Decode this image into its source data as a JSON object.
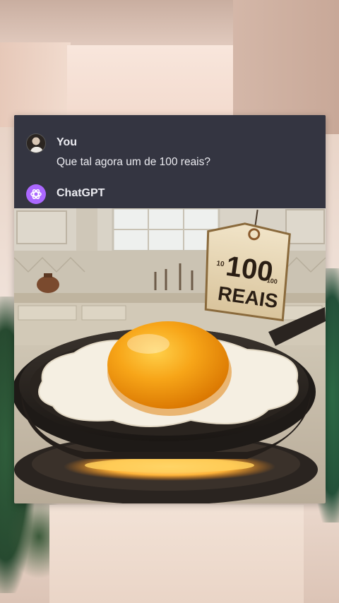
{
  "chat": {
    "user": {
      "name": "You",
      "message": "Que tal agora um de 100 reais?"
    },
    "assistant": {
      "name": "ChatGPT"
    }
  },
  "image": {
    "tag_number": "100",
    "tag_word": "REAIS",
    "tag_small_left": "10",
    "tag_small_right": "100"
  },
  "icons": {
    "user_avatar": "user-avatar-icon",
    "assistant_logo": "openai-logo-icon"
  },
  "colors": {
    "card_bg": "#343541",
    "text": "#ececf1",
    "gpt_accent": "#ab68ff",
    "yolk": "#f6a316"
  }
}
